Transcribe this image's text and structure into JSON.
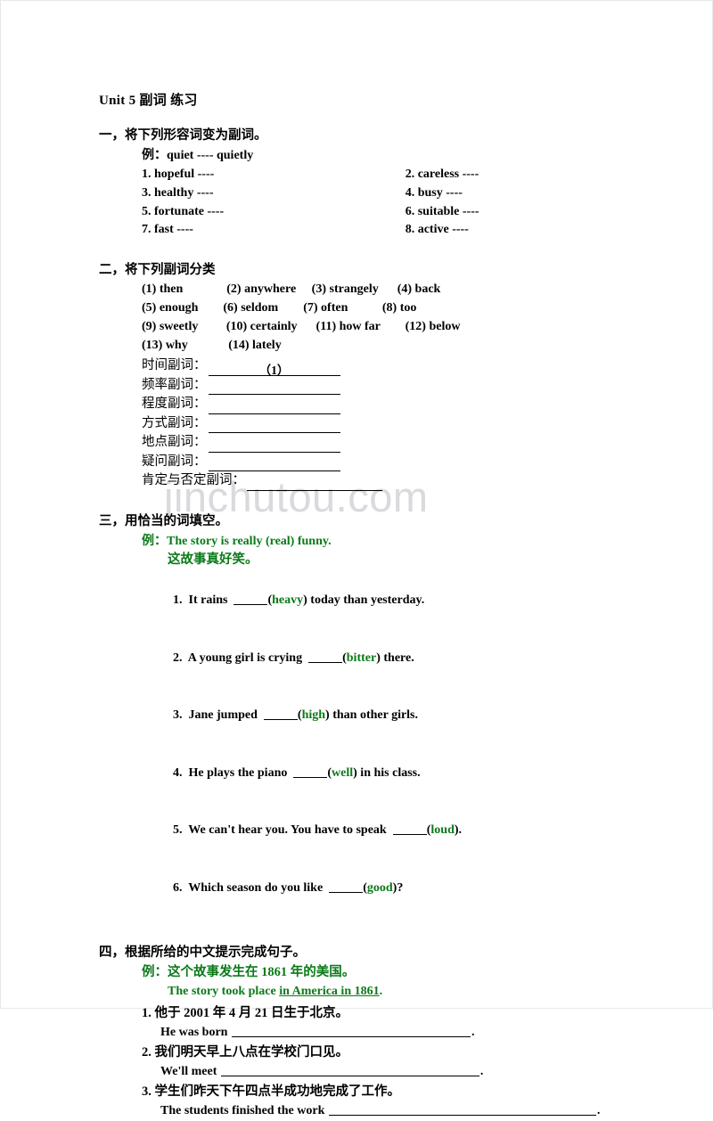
{
  "document": {
    "title": "Unit 5  副词  练习",
    "watermark": "jinchutou.com",
    "accent_green": "#0a7a18"
  },
  "section1": {
    "heading": "一，将下列形容词变为副词。",
    "example": "例：quiet ---- quietly",
    "items": [
      {
        "left": "1. hopeful ----",
        "right": "2. careless ----"
      },
      {
        "left": "3. healthy ----",
        "right": "4. busy ----"
      },
      {
        "left": "5. fortunate ----",
        "right": "6. suitable ----"
      },
      {
        "left": "7. fast ----",
        "right": "8. active ----"
      }
    ]
  },
  "section2": {
    "heading": "二，将下列副词分类",
    "word_lines": [
      "(1) then              (2) anywhere     (3) strangely      (4) back",
      "(5) enough        (6) seldom        (7) often           (8) too",
      "(9) sweetly         (10) certainly      (11) how far        (12) below",
      "(13) why             (14) lately"
    ],
    "categories": [
      {
        "label": "时间副词：",
        "answer": "（1）",
        "width": "short"
      },
      {
        "label": "频率副词：",
        "answer": "",
        "width": "short"
      },
      {
        "label": "程度副词：",
        "answer": "",
        "width": "short"
      },
      {
        "label": "方式副词：",
        "answer": "",
        "width": "short"
      },
      {
        "label": "地点副词：",
        "answer": "",
        "width": "short"
      },
      {
        "label": "疑问副词：",
        "answer": "",
        "width": "short"
      },
      {
        "label": "肯定与否定副词：",
        "answer": "",
        "width": "long"
      }
    ]
  },
  "section3": {
    "heading": "三，用恰当的词填空。",
    "example_label": "例：",
    "example_en": "The story is really (real) funny.",
    "example_cn": "这故事真好笑。",
    "questions": [
      {
        "num": "1.",
        "pre": "It rains  ",
        "cue": "heavy",
        "post": ") today than yesterday."
      },
      {
        "num": "2.",
        "pre": "A young girl is crying  ",
        "cue": "bitter",
        "post": ") there."
      },
      {
        "num": "3.",
        "pre": "Jane jumped  ",
        "cue": "high",
        "post": ") than other girls."
      },
      {
        "num": "4.",
        "pre": "He plays the piano  ",
        "cue": "well",
        "post": ") in his class."
      },
      {
        "num": "5.",
        "pre": "We can't hear you. You have to speak  ",
        "cue": "loud",
        "post": ")."
      },
      {
        "num": "6.",
        "pre": "Which season do you like  ",
        "cue": "good",
        "post": ")?"
      }
    ]
  },
  "section4": {
    "heading": "四，根据所给的中文提示完成句子。",
    "example_label": "例：",
    "example_cn": "这个故事发生在 1861 年的美国。",
    "example_en_pre": "The story took place ",
    "example_en_underlined": "in America in 1861",
    "example_en_post": ".",
    "items": [
      {
        "num": "1.",
        "cn": "他于 2001 年 4 月 21 日生于北京。",
        "en": "He was born",
        "fill": "f1"
      },
      {
        "num": "2.",
        "cn": "我们明天早上八点在学校门口见。",
        "en": "We'll meet",
        "fill": "f2"
      },
      {
        "num": "3.",
        "cn": "学生们昨天下午四点半成功地完成了工作。",
        "en": "The students finished the work",
        "fill": "f3"
      }
    ]
  }
}
